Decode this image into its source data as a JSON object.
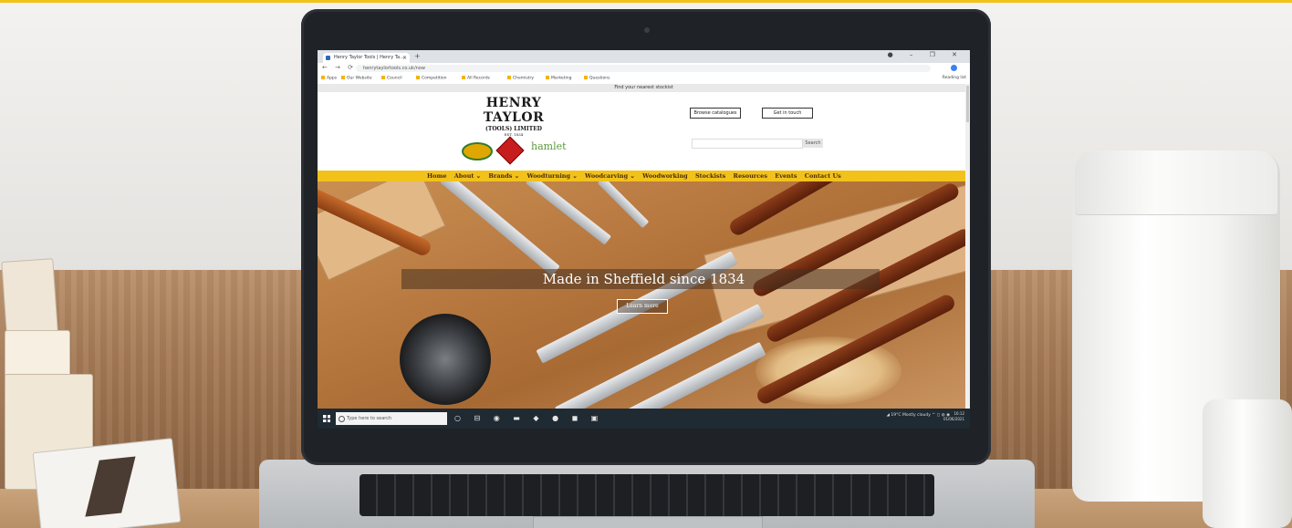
{
  "browser": {
    "tab_title": "Henry Taylor Tools | Henry Ta...",
    "tab_close": "×",
    "new_tab": "+",
    "window_controls": "● – ❐ ✕",
    "nav": "← → ⟳",
    "url": "henrytaylortools.co.uk/now",
    "bookmarks": [
      "Apps",
      "Our Website",
      "Council",
      "Competition",
      "All Records",
      "Chemistry",
      "Marketing",
      "Questions"
    ],
    "reading_list": "Reading list"
  },
  "site": {
    "announcement": "Find your nearest stockist",
    "brand_name": "HENRY TAYLOR",
    "brand_sub": "(TOOLS) LIMITED",
    "brand_est": "EST. 1834",
    "hamlet_logo": "hamlet",
    "btn_catalogue": "Browse catalogues",
    "btn_contact": "Get in touch",
    "search_button": "Search",
    "nav": [
      "Home",
      "About ⌄",
      "Brands ⌄",
      "Woodturning ⌄",
      "Woodcarving ⌄",
      "Woodworking",
      "Stockists",
      "Resources",
      "Events",
      "Contact Us"
    ],
    "hero_caption": "Made in Sheffield since 1834",
    "hero_button": "Learn more"
  },
  "taskbar": {
    "search_placeholder": "Type here to search",
    "apps": "○ ⊟ ◉ ▬ ◆ ● ◼ ▣",
    "tray": "◢ 19°C  Mostly cloudy  ^ ◻ ◍ ◉",
    "time": "16:12",
    "date": "01/06/2021"
  }
}
